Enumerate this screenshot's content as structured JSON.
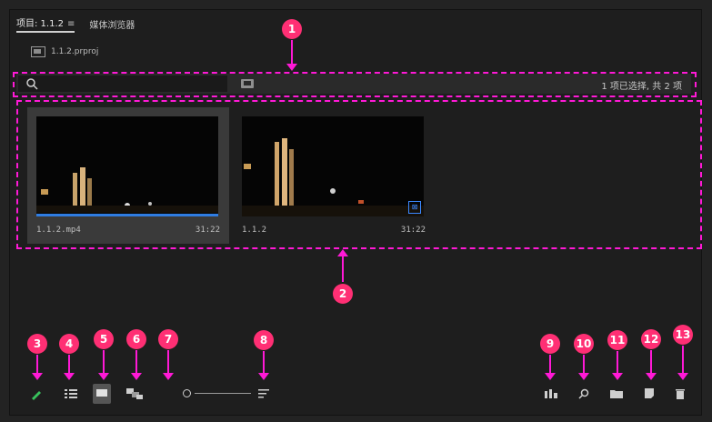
{
  "tabs": [
    {
      "label": "项目: 1.1.2",
      "menu_icon": "hamburger-menu-icon"
    },
    {
      "label": "媒体浏览器"
    }
  ],
  "project": {
    "file": "1.1.2.prproj"
  },
  "search": {
    "placeholder": "",
    "status": "1 项已选择, 共 2 项"
  },
  "clips": [
    {
      "name": "1.1.2.mp4",
      "duration": "31:22",
      "selected": true
    },
    {
      "name": "1.1.2",
      "duration": "31:22",
      "selected": false
    }
  ],
  "annotations": [
    "1",
    "2",
    "3",
    "4",
    "5",
    "6",
    "7",
    "8",
    "9",
    "10",
    "11",
    "12",
    "13"
  ],
  "toolbar": {
    "left": [
      "pencil-icon",
      "list-view-icon",
      "icon-view-icon",
      "freeform-view-icon",
      "zoom-slider-icon"
    ],
    "sort": "sort-icon",
    "right": [
      "automate-to-sequence-icon",
      "find-icon",
      "new-bin-icon",
      "new-item-icon",
      "clear-trash-icon"
    ]
  },
  "colors": {
    "annotation": "#ff19d6",
    "marker": "#ff2f74",
    "accent": "#2f7de3",
    "panel": "#1e1e1e"
  }
}
